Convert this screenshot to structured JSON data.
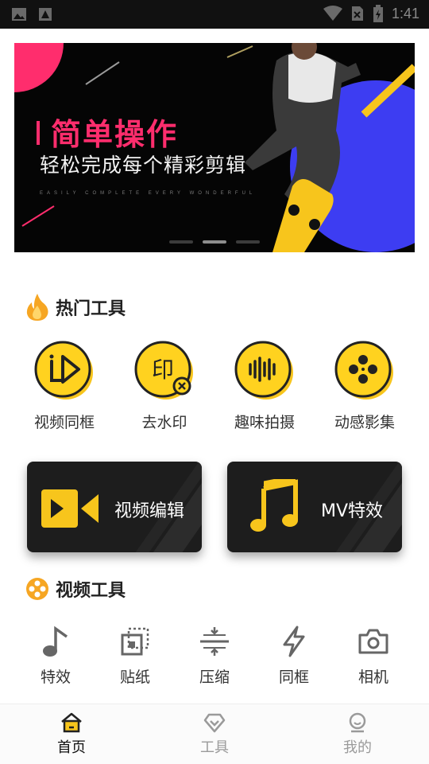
{
  "status_bar": {
    "time": "1:41",
    "icons": [
      "image-icon",
      "image-icon",
      "wifi-icon",
      "no-sim-icon",
      "battery-icon"
    ]
  },
  "banner": {
    "title": "简单操作",
    "subtitle": "轻松完成每个精彩剪辑",
    "tagline": "EASILY COMPLETE EVERY WONDERFUL",
    "page_count": 3,
    "active_page": 2
  },
  "hot_section": {
    "title": "热门工具",
    "icon": "fire-icon",
    "items": [
      {
        "label": "视频同框",
        "icon": "play-video-icon"
      },
      {
        "label": "去水印",
        "icon": "remove-watermark-icon"
      },
      {
        "label": "趣味拍摄",
        "icon": "soundwave-icon"
      },
      {
        "label": "动感影集",
        "icon": "film-reel-icon"
      }
    ]
  },
  "cards": {
    "video_edit": {
      "label": "视频编辑",
      "icon": "video-camera-icon"
    },
    "mv_effect": {
      "label": "MV特效",
      "icon": "music-note-icon"
    }
  },
  "video_section": {
    "title": "视频工具",
    "icon": "film-reel-icon",
    "items": [
      {
        "label": "特效",
        "icon": "music-note-icon"
      },
      {
        "label": "贴纸",
        "icon": "sticker-icon"
      },
      {
        "label": "压缩",
        "icon": "compress-icon"
      },
      {
        "label": "同框",
        "icon": "lightning-icon"
      },
      {
        "label": "相机",
        "icon": "camera-icon"
      }
    ]
  },
  "bottom_nav": {
    "items": [
      {
        "label": "首页",
        "icon": "home-icon",
        "active": true
      },
      {
        "label": "工具",
        "icon": "diamond-icon",
        "active": false
      },
      {
        "label": "我的",
        "icon": "user-icon",
        "active": false
      }
    ]
  },
  "colors": {
    "accent_yellow": "#f7c51c",
    "banner_pink": "#ff2d6d",
    "banner_blue": "#3d3df2",
    "dark_card": "#1d1d1d"
  }
}
